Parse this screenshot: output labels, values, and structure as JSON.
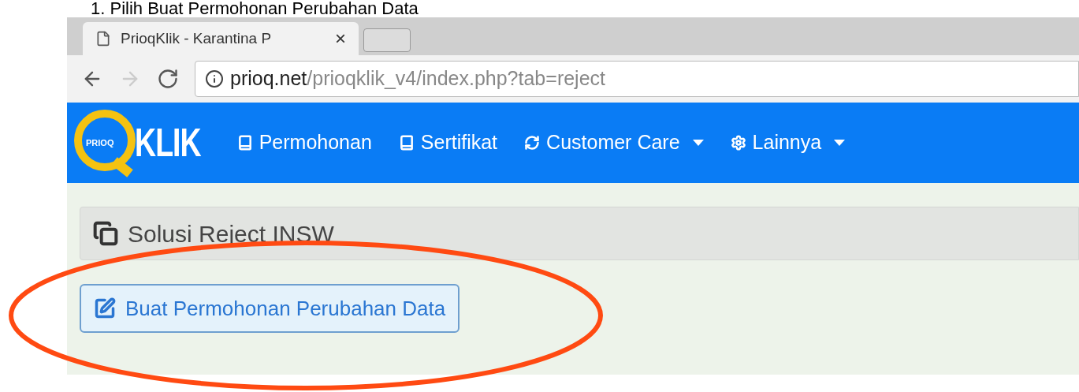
{
  "caption": "1. Pilih Buat Permohonan Perubahan Data",
  "browser": {
    "tab": {
      "title": "PrioqKlik - Karantina P",
      "close": "×"
    },
    "address": {
      "domain": "prioq.net",
      "path": "/prioqklik_v4/index.php?tab=reject"
    }
  },
  "navbar": {
    "logo": {
      "badge": "PRIOQ",
      "word": "KLIK"
    },
    "items": [
      {
        "label": "Permohonan",
        "kind": "book",
        "dropdown": false
      },
      {
        "label": "Sertifikat",
        "kind": "book",
        "dropdown": false
      },
      {
        "label": "Customer Care",
        "kind": "sync",
        "dropdown": true
      },
      {
        "label": "Lainnya",
        "kind": "cog",
        "dropdown": true
      }
    ]
  },
  "panel": {
    "title": "Solusi Reject INSW"
  },
  "action_button": {
    "label": "Buat Permohonan Perubahan Data"
  }
}
